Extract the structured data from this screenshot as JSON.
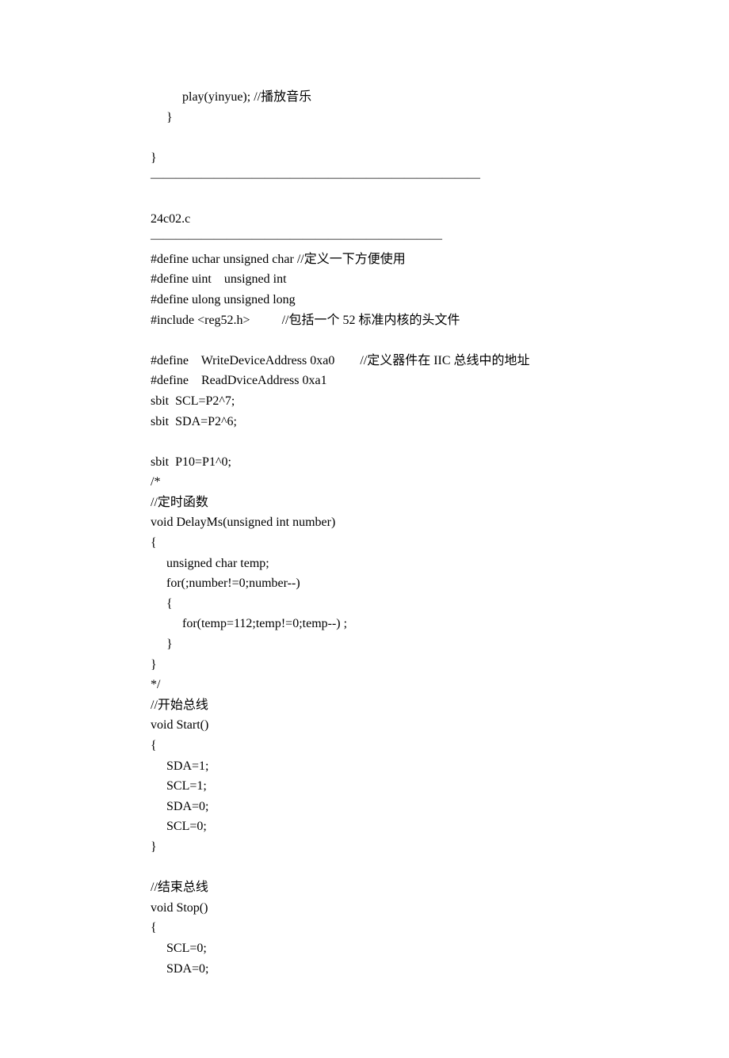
{
  "lines": [
    "          play(yinyue); //播放音乐",
    "     }",
    "",
    "}",
    "――――――――――――――――――――――――――",
    "",
    "24c02.c",
    "―――――――――――――――――――――――",
    "#define uchar unsigned char //定义一下方便使用",
    "#define uint    unsigned int",
    "#define ulong unsigned long",
    "#include <reg52.h>          //包括一个 52 标准内核的头文件",
    "",
    "#define    WriteDeviceAddress 0xa0        //定义器件在 IIC 总线中的地址",
    "#define    ReadDviceAddress 0xa1",
    "sbit  SCL=P2^7;",
    "sbit  SDA=P2^6;",
    "",
    "sbit  P10=P1^0;",
    "/*",
    "//定时函数",
    "void DelayMs(unsigned int number)",
    "{",
    "     unsigned char temp;",
    "     for(;number!=0;number--)",
    "     {",
    "          for(temp=112;temp!=0;temp--) ;",
    "     }",
    "}",
    "*/",
    "//开始总线",
    "void Start()",
    "{",
    "     SDA=1;",
    "     SCL=1;",
    "     SDA=0;",
    "     SCL=0;",
    "}",
    "",
    "//结束总线",
    "void Stop()",
    "{",
    "     SCL=0;",
    "     SDA=0;"
  ]
}
